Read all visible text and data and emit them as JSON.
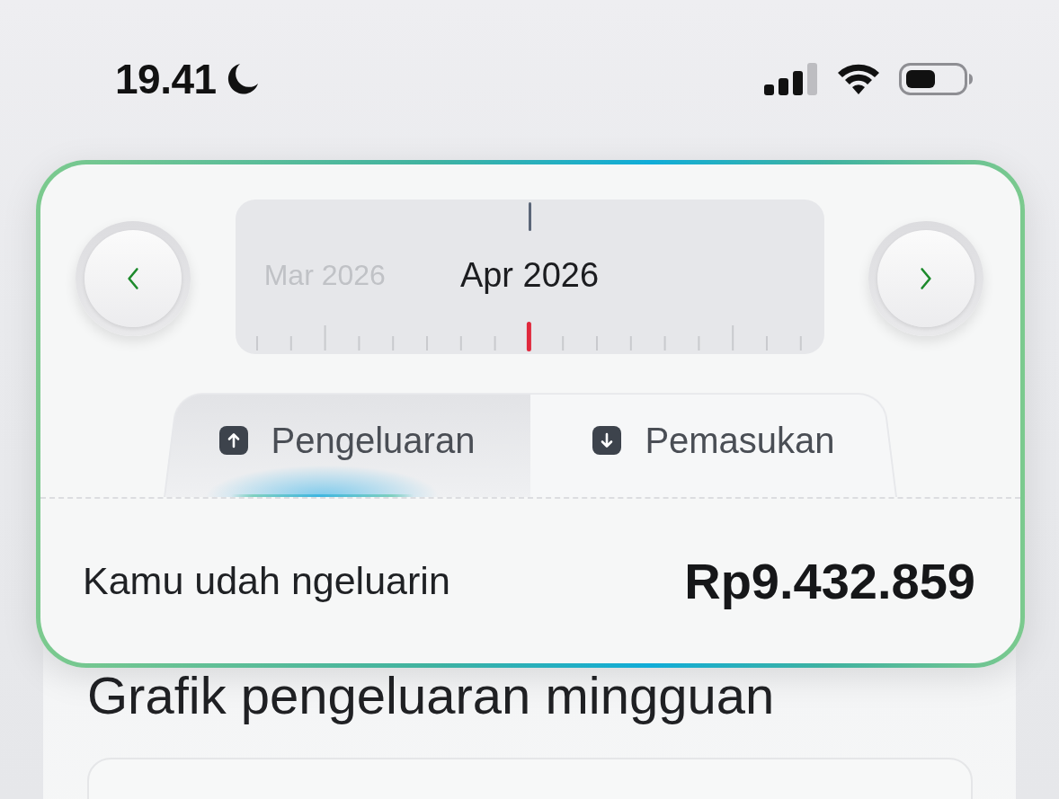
{
  "status_bar": {
    "time": "19.41"
  },
  "month_picker": {
    "months": [
      {
        "label": "Mar 2026",
        "selected": false
      },
      {
        "label": "Apr 2026",
        "selected": true
      }
    ]
  },
  "tabs": [
    {
      "label": "Pengeluaran",
      "kind": "expense",
      "selected": true
    },
    {
      "label": "Pemasukan",
      "kind": "income",
      "selected": false
    }
  ],
  "summary": {
    "label": "Kamu udah ngeluarin",
    "amount": "Rp9.432.859"
  },
  "weekly_chart": {
    "title": "Grafik pengeluaran mingguan"
  }
}
